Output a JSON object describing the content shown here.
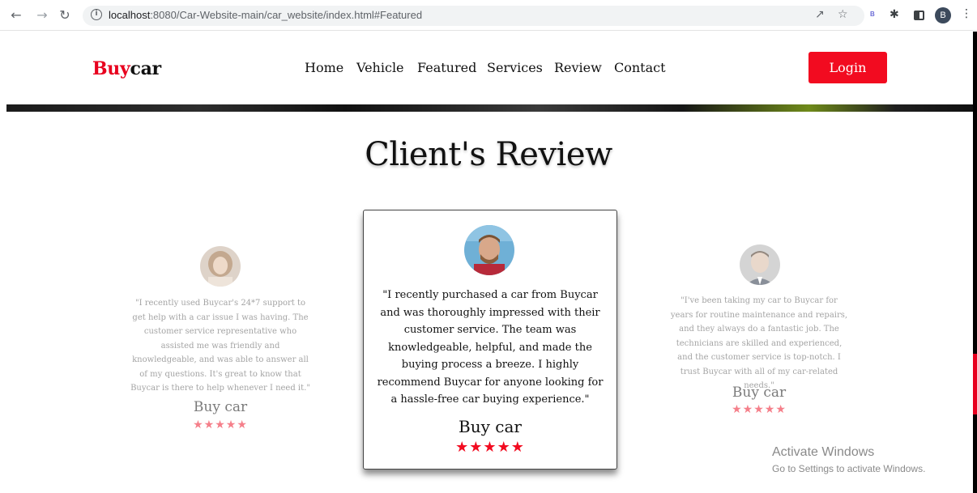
{
  "browser": {
    "url_host": "localhost",
    "url_rest": ":8080/Car-Website-main/car_website/index.html#Featured",
    "back_icon": "arrow-left-icon",
    "forward_icon": "arrow-right-icon",
    "reload_icon": "reload-icon",
    "extension_label": "B",
    "profile_initial": "B"
  },
  "site": {
    "logo_part1": "Buy",
    "logo_part2": "car",
    "nav": [
      "Home",
      "Vehicle",
      "Featured",
      "Services",
      "Review",
      "Contact"
    ],
    "login_label": "Login",
    "accent_color": "#f20b20"
  },
  "reviews": {
    "title": "Client's Review",
    "items": [
      {
        "text": "\"I recently used Buycar's 24*7 support to get help with a car issue I was having. The customer service representative who assisted me was friendly and knowledgeable, and was able to answer all of my questions. It's great to know that Buycar is there to help whenever I need it.\"",
        "name": "Buy car",
        "stars": "★★★★★",
        "rating": 5
      },
      {
        "text": "\"I recently purchased a car from Buycar and was thoroughly impressed with their customer service. The team was knowledgeable, helpful, and made the buying process a breeze. I highly recommend Buycar for anyone looking for a hassle-free car buying experience.\"",
        "name": "Buy car",
        "stars": "★★★★★",
        "rating": 5
      },
      {
        "text": "\"I've been taking my car to Buycar for years for routine maintenance and repairs, and they always do a fantastic job. The technicians are skilled and experienced, and the customer service is top-notch. I trust Buycar with all of my car-related needs.\"",
        "name": "Buy car",
        "stars": "★★★★★",
        "rating": 5
      }
    ]
  },
  "watermark": {
    "title": "Activate Windows",
    "subtitle": "Go to Settings to activate Windows."
  }
}
